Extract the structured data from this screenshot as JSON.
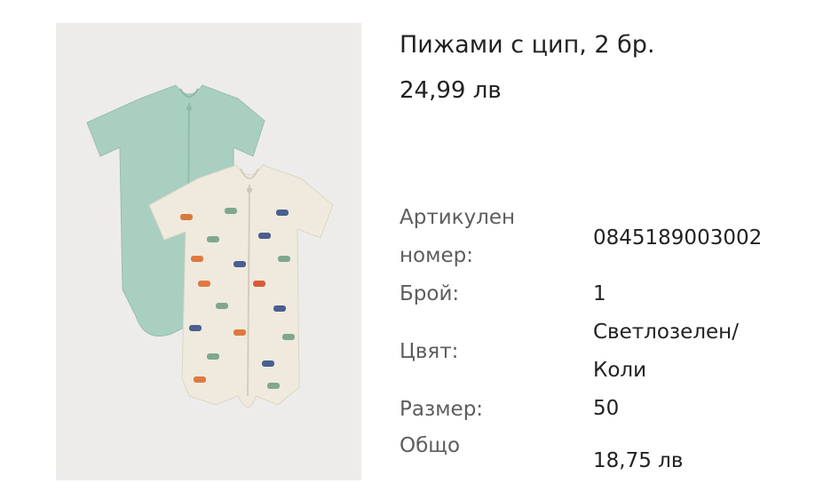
{
  "product": {
    "title": "Пижами с цип, 2 бр.",
    "price": "24,99 лв",
    "image_description": "two-baby-rompers"
  },
  "details": {
    "article_label_line1": "Артикулен",
    "article_label_line2": "номер:",
    "article_value": "0845189003002",
    "quantity_label": "Брой:",
    "quantity_value": "1",
    "color_label": "Цвят:",
    "color_value_line1": "Светлозелен/",
    "color_value_line2": "Коли",
    "size_label": "Размер:",
    "size_value": "50",
    "total_label": "Общо",
    "total_value": "18,75 лв"
  },
  "colors": {
    "image_bg": "#eeecea",
    "romper_green": "#a8cfc0",
    "romper_cream": "#eee9dc"
  }
}
